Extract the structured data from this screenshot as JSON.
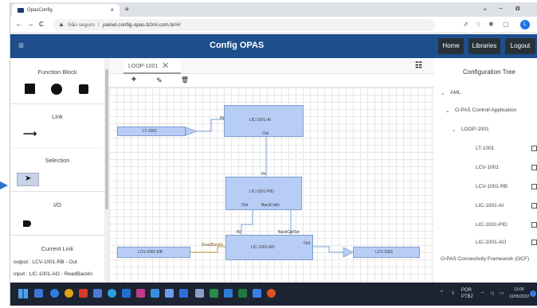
{
  "browser": {
    "tab_title": "OpasConfig",
    "tab_close": "×",
    "new_tab": "+",
    "win_min": "⌄",
    "win_dash": "–",
    "win_max": "ɑ",
    "nav_back": "←",
    "nav_forward": "→",
    "nav_reload": "C",
    "security_text": "Não seguro",
    "url": "painel.config-opas.b2ml.com.br/#/",
    "profile_initial": "L"
  },
  "header": {
    "menu_icon": "≡",
    "title": "Config OPAS",
    "buttons": [
      "Home",
      "Libraries",
      "Logout"
    ]
  },
  "palette": {
    "sections": [
      {
        "title": "Function Block"
      },
      {
        "title": "Link"
      },
      {
        "title": "Selection"
      },
      {
        "title": "I/O"
      },
      {
        "title": "Current Link"
      }
    ],
    "link_icon": "⟶",
    "current_link": {
      "output": "output : LCV-1001-RB - Out",
      "input": "input : LIC-1001-AO - ReadBackIn"
    }
  },
  "editor": {
    "tab_label": "LOOP-1001",
    "tab_close": "✕",
    "tools": {
      "add": "+",
      "edit": "✎",
      "delete": "🗑"
    },
    "blocks": {
      "lic_ai": {
        "title": "LIC-1001-AI",
        "in_label": "IN",
        "out_label": "Out"
      },
      "lic_pid": {
        "title": "LIC-1001-PID",
        "in_label": "IN",
        "out_label": "Out",
        "out2_label": "BackCalIn"
      },
      "lic_ao": {
        "title": "LIC-1001-AO",
        "in_label": "IN",
        "readback_label": "ReadBackIn",
        "out_label": "Out",
        "backcal_label": "BackCalOut"
      },
      "lt": {
        "title": "LT-1001"
      },
      "lcv_rb": {
        "title": "LCV-1001-RB"
      },
      "lcv": {
        "title": "LCV-1001"
      }
    }
  },
  "tree": {
    "title": "Configuration Tree",
    "items": [
      {
        "label": "AML",
        "level": 0
      },
      {
        "label": "O-PAS Controll Application",
        "level": 1
      },
      {
        "label": "LOOP-1001",
        "level": 2
      },
      {
        "label": "LT-1001",
        "level": 3
      },
      {
        "label": "LCV-1001",
        "level": 3
      },
      {
        "label": "LCV-1001-RB",
        "level": 3
      },
      {
        "label": "LIC-1001-AI",
        "level": 3
      },
      {
        "label": "LIC-1001-PID",
        "level": 3
      },
      {
        "label": "LIC-1001-AO",
        "level": 3
      },
      {
        "label": "O-PAS Connectivity Framework (OCF)",
        "level": 1
      }
    ]
  },
  "taskbar": {
    "lang": "POR",
    "lang2": "PTB2",
    "time": "13:09",
    "date": "10/05/2022"
  },
  "colors": {
    "app_header": "#1e4e8c",
    "block_fill": "#b8cdf5",
    "block_border": "#7f9fd1",
    "wire": "#7aa3d6",
    "taskbar": "#1c2333"
  }
}
